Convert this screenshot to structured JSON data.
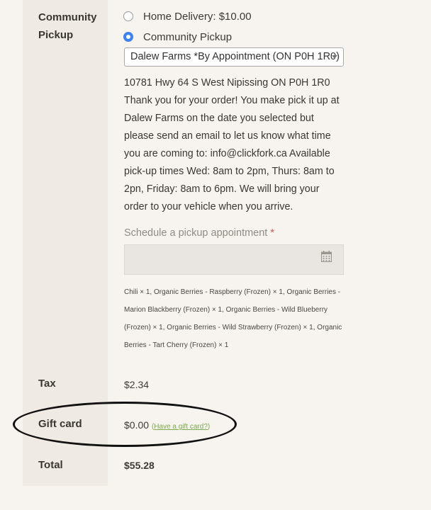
{
  "shipping": {
    "label": "Community Pickup",
    "options": [
      {
        "label": "Home Delivery: $10.00",
        "selected": false
      },
      {
        "label": "Community Pickup",
        "selected": true
      }
    ],
    "pickup_location": "Dalew Farms *By Appointment (ON P0H 1R0)",
    "description": "10781 Hwy 64 S West Nipissing ON P0H 1R0 Thank you for your order! You make pick it up at Dalew Farms on the date you selected but please send an email to let us know what time you are coming to:  info@clickfork.ca Available pick-up times Wed: 8am to 2pm, Thurs: 8am to 2pn, Friday: 8am to 6pm. We will bring your order to your vehicle when you arrive.",
    "schedule_label": "Schedule a pickup appointment",
    "schedule_required": "*",
    "schedule_value": "",
    "items": "Chili × 1, Organic Berries - Raspberry (Frozen) × 1, Organic Berries - Marion Blackberry (Frozen) × 1, Organic Berries - Wild Blueberry (Frozen) × 1, Organic Berries - Wild Strawberry (Frozen) × 1, Organic Berries - Tart Cherry (Frozen) × 1"
  },
  "tax": {
    "label": "Tax",
    "value": "$2.34"
  },
  "gift_card": {
    "label": "Gift card",
    "value": "$0.00",
    "link_open": "(",
    "link": "Have a gift card?",
    "link_close": ")"
  },
  "total": {
    "label": "Total",
    "value": "$55.28"
  },
  "colors": {
    "accent": "#3b82f6",
    "link": "#7ba84a",
    "required": "#d9534f"
  }
}
